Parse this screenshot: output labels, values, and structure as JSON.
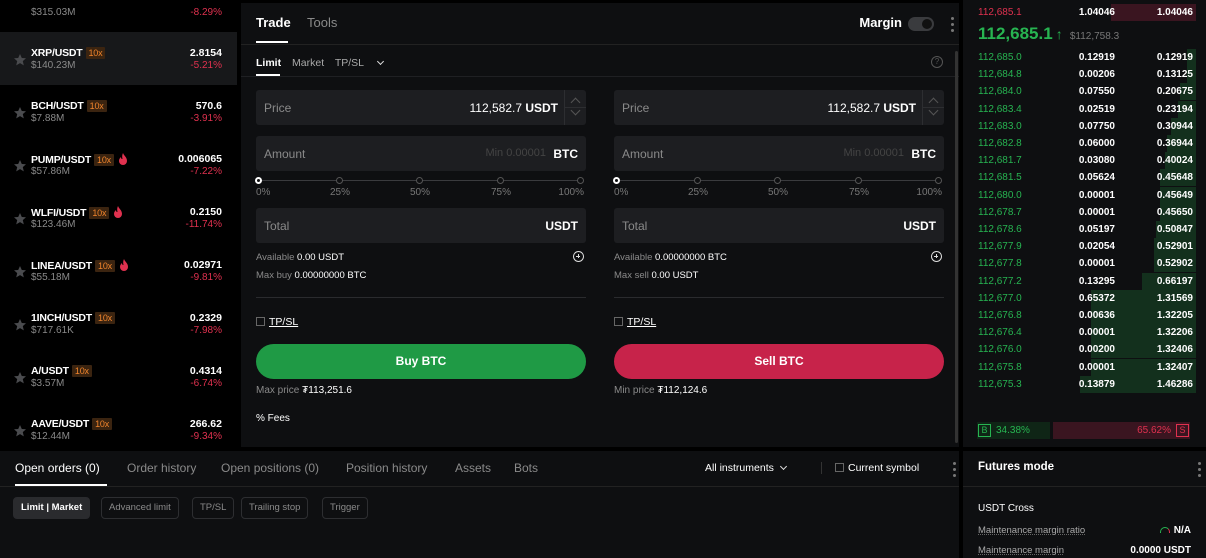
{
  "markets": [
    {
      "pair": "",
      "leverage": "",
      "hot": false,
      "volume": "$315.03M",
      "price": "",
      "change": "-8.29%",
      "active": false
    },
    {
      "pair": "XRP/USDT",
      "leverage": "10x",
      "hot": false,
      "volume": "$140.23M",
      "price": "2.8154",
      "change": "-5.21%",
      "active": true
    },
    {
      "pair": "BCH/USDT",
      "leverage": "10x",
      "hot": false,
      "volume": "$7.88M",
      "price": "570.6",
      "change": "-3.91%",
      "active": false
    },
    {
      "pair": "PUMP/USDT",
      "leverage": "10x",
      "hot": true,
      "volume": "$57.86M",
      "price": "0.006065",
      "change": "-7.22%",
      "active": false
    },
    {
      "pair": "WLFI/USDT",
      "leverage": "10x",
      "hot": true,
      "volume": "$123.46M",
      "price": "0.2150",
      "change": "-11.74%",
      "active": false
    },
    {
      "pair": "LINEA/USDT",
      "leverage": "10x",
      "hot": true,
      "volume": "$55.18M",
      "price": "0.02971",
      "change": "-9.81%",
      "active": false
    },
    {
      "pair": "1INCH/USDT",
      "leverage": "10x",
      "hot": false,
      "volume": "$717.61K",
      "price": "0.2329",
      "change": "-7.98%",
      "active": false
    },
    {
      "pair": "A/USDT",
      "leverage": "10x",
      "hot": false,
      "volume": "$3.57M",
      "price": "0.4314",
      "change": "-6.74%",
      "active": false
    },
    {
      "pair": "AAVE/USDT",
      "leverage": "10x",
      "hot": false,
      "volume": "$12.44M",
      "price": "266.62",
      "change": "-9.34%",
      "active": false
    }
  ],
  "trade": {
    "tab_trade": "Trade",
    "tab_tools": "Tools",
    "margin_label": "Margin",
    "margin_enabled": false,
    "order_types": {
      "limit": "Limit",
      "market": "Market",
      "tpsl": "TP/SL"
    },
    "buy": {
      "price_label": "Price",
      "price_value": "112,582.7",
      "price_unit": "USDT",
      "amount_label": "Amount",
      "amount_placeholder": "Min 0.00001",
      "amount_unit": "BTC",
      "total_label": "Total",
      "total_unit": "USDT",
      "available_label": "Available",
      "available_value": "0.00 USDT",
      "max_label": "Max buy",
      "max_value": "0.00000000 BTC",
      "tpsl_label": "TP/SL",
      "button_label": "Buy BTC",
      "price_limit_label": "Max price",
      "price_limit_value": "₮113,251.6",
      "fees_label": "% Fees"
    },
    "sell": {
      "price_label": "Price",
      "price_value": "112,582.7",
      "price_unit": "USDT",
      "amount_label": "Amount",
      "amount_placeholder": "Min 0.00001",
      "amount_unit": "BTC",
      "total_label": "Total",
      "total_unit": "USDT",
      "available_label": "Available",
      "available_value": "0.00000000 BTC",
      "max_label": "Max sell",
      "max_value": "0.00 USDT",
      "tpsl_label": "TP/SL",
      "button_label": "Sell BTC",
      "price_limit_label": "Min price",
      "price_limit_value": "₮112,124.6"
    },
    "slider_marks": [
      "0%",
      "25%",
      "50%",
      "75%",
      "100%"
    ],
    "slider_value_pct": 0
  },
  "orderbook": {
    "top_ask": {
      "price": "112,685.1",
      "qty": "1.04046",
      "total": "1.04046",
      "fill": 0.38
    },
    "last_price": "112,685.1",
    "mark_price": "$112,758.3",
    "bids": [
      {
        "price": "112,685.0",
        "qty": "0.12919",
        "total": "0.12919",
        "fill": 0.04
      },
      {
        "price": "112,684.8",
        "qty": "0.00206",
        "total": "0.13125",
        "fill": 0.04
      },
      {
        "price": "112,684.0",
        "qty": "0.07550",
        "total": "0.20675",
        "fill": 0.07
      },
      {
        "price": "112,683.4",
        "qty": "0.02519",
        "total": "0.23194",
        "fill": 0.08
      },
      {
        "price": "112,683.0",
        "qty": "0.07750",
        "total": "0.30944",
        "fill": 0.11
      },
      {
        "price": "112,682.8",
        "qty": "0.06000",
        "total": "0.36944",
        "fill": 0.13
      },
      {
        "price": "112,681.7",
        "qty": "0.03080",
        "total": "0.40024",
        "fill": 0.14
      },
      {
        "price": "112,681.5",
        "qty": "0.05624",
        "total": "0.45648",
        "fill": 0.16
      },
      {
        "price": "112,680.0",
        "qty": "0.00001",
        "total": "0.45649",
        "fill": 0.16
      },
      {
        "price": "112,678.7",
        "qty": "0.00001",
        "total": "0.45650",
        "fill": 0.16
      },
      {
        "price": "112,678.6",
        "qty": "0.05197",
        "total": "0.50847",
        "fill": 0.18
      },
      {
        "price": "112,677.9",
        "qty": "0.02054",
        "total": "0.52901",
        "fill": 0.19
      },
      {
        "price": "112,677.8",
        "qty": "0.00001",
        "total": "0.52902",
        "fill": 0.19
      },
      {
        "price": "112,677.2",
        "qty": "0.13295",
        "total": "0.66197",
        "fill": 0.24
      },
      {
        "price": "112,677.0",
        "qty": "0.65372",
        "total": "1.31569",
        "fill": 0.47
      },
      {
        "price": "112,676.8",
        "qty": "0.00636",
        "total": "1.32205",
        "fill": 0.47
      },
      {
        "price": "112,676.4",
        "qty": "0.00001",
        "total": "1.32206",
        "fill": 0.47
      },
      {
        "price": "112,676.0",
        "qty": "0.00200",
        "total": "1.32406",
        "fill": 0.47
      },
      {
        "price": "112,675.8",
        "qty": "0.00001",
        "total": "1.32407",
        "fill": 0.47
      },
      {
        "price": "112,675.3",
        "qty": "0.13879",
        "total": "1.46286",
        "fill": 0.52
      }
    ],
    "buy_tag": "B",
    "sell_tag": "S",
    "buy_ratio": "34.38%",
    "sell_ratio": "65.62%",
    "buy_ratio_value": 34.38
  },
  "orders": {
    "tabs": [
      "Open orders (0)",
      "Order history",
      "Open positions (0)",
      "Position history",
      "Assets",
      "Bots"
    ],
    "active_tab": 0,
    "instruments_label": "All instruments",
    "current_symbol_label": "Current symbol",
    "chips": [
      "Limit | Market",
      "Advanced limit",
      "TP/SL",
      "Trailing stop",
      "Trigger"
    ],
    "active_chip": 0
  },
  "futures": {
    "title": "Futures mode",
    "mode": "USDT Cross",
    "mm_ratio_label": "Maintenance margin ratio",
    "mm_ratio_value": "N/A",
    "mm_label": "Maintenance margin",
    "mm_value": "0.0000 USDT"
  },
  "colors": {
    "up": "#27b451",
    "down": "#e0314f",
    "buy": "#1f9a45",
    "sell": "#c7234a",
    "leverage": "#f0842c"
  }
}
